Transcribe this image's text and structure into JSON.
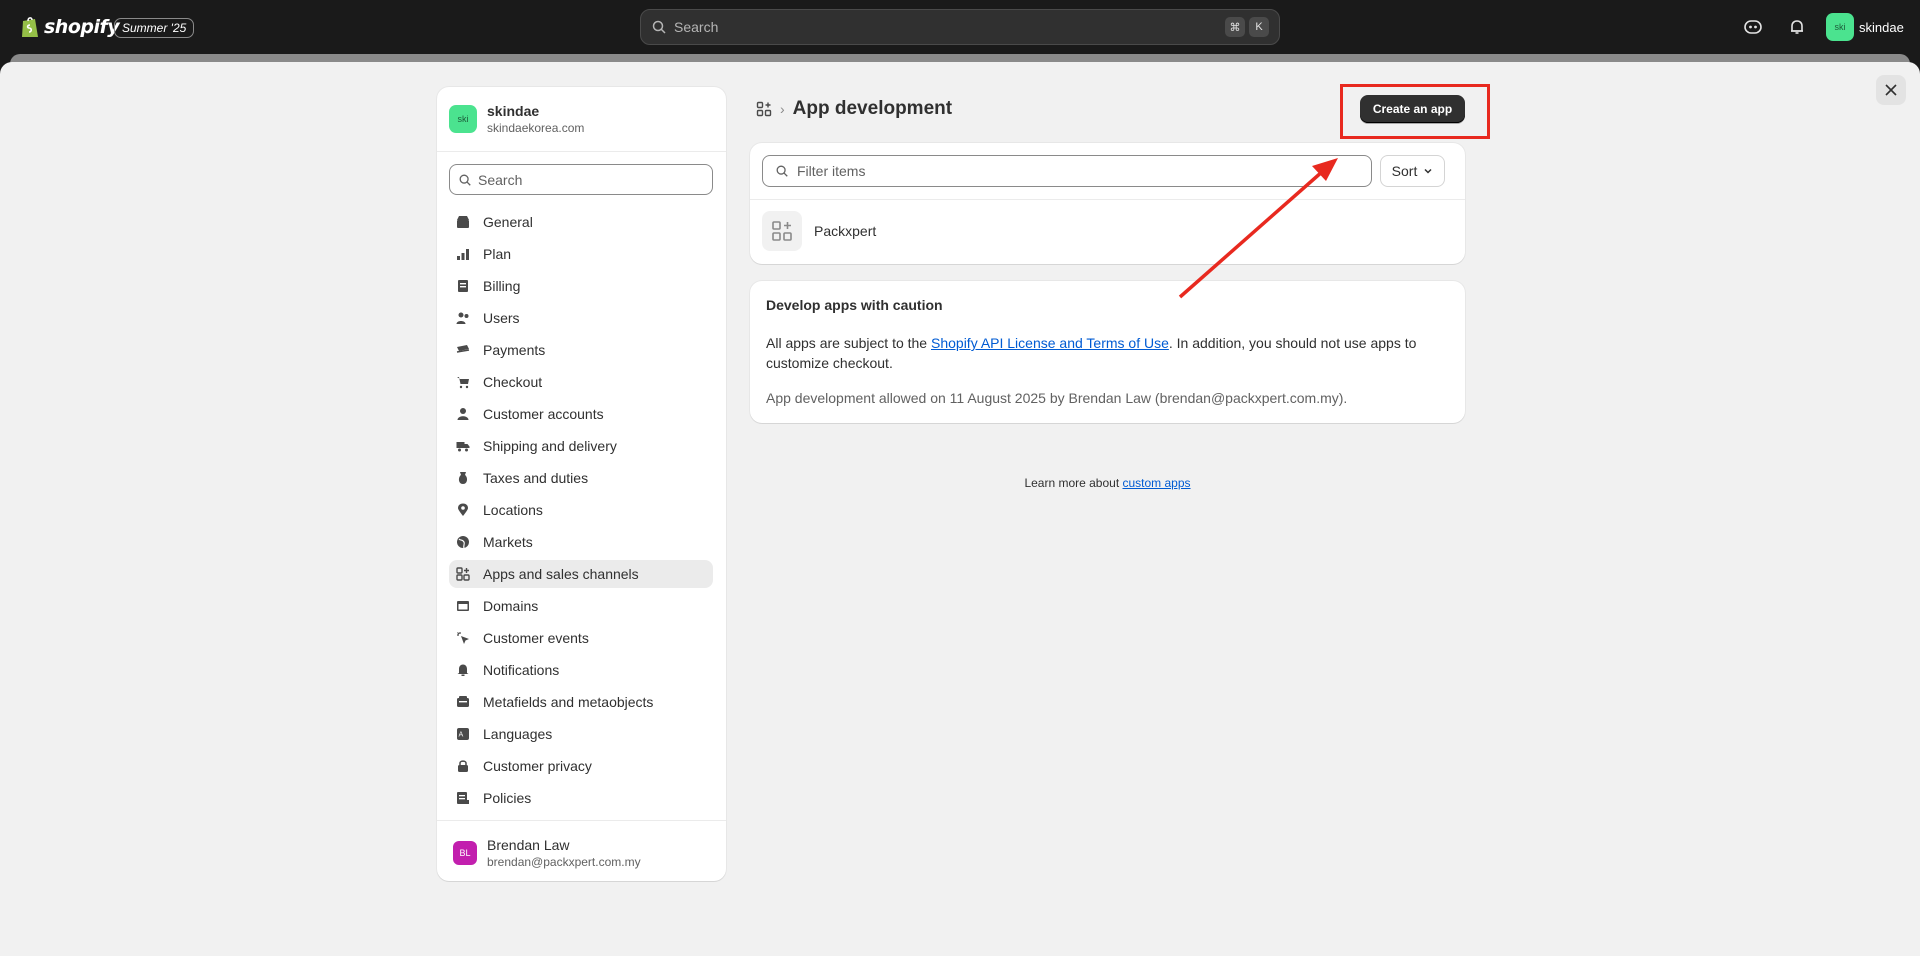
{
  "topbar": {
    "brand": "shopify",
    "edition_badge": "Summer '25",
    "search_placeholder": "Search",
    "shortcut_keys": [
      "⌘",
      "K"
    ],
    "store_name": "skindae",
    "store_avatar": "ski"
  },
  "sidebar": {
    "store": {
      "avatar": "ski",
      "name": "skindae",
      "domain": "skindaekorea.com"
    },
    "search_placeholder": "Search",
    "items": [
      {
        "label": "General",
        "icon": "store-icon"
      },
      {
        "label": "Plan",
        "icon": "plan-icon"
      },
      {
        "label": "Billing",
        "icon": "billing-icon"
      },
      {
        "label": "Users",
        "icon": "users-icon"
      },
      {
        "label": "Payments",
        "icon": "payments-icon"
      },
      {
        "label": "Checkout",
        "icon": "cart-icon"
      },
      {
        "label": "Customer accounts",
        "icon": "person-icon"
      },
      {
        "label": "Shipping and delivery",
        "icon": "truck-icon"
      },
      {
        "label": "Taxes and duties",
        "icon": "tax-icon"
      },
      {
        "label": "Locations",
        "icon": "location-icon"
      },
      {
        "label": "Markets",
        "icon": "globe-icon"
      },
      {
        "label": "Apps and sales channels",
        "icon": "apps-icon",
        "active": true
      },
      {
        "label": "Domains",
        "icon": "domain-icon"
      },
      {
        "label": "Customer events",
        "icon": "cursor-icon"
      },
      {
        "label": "Notifications",
        "icon": "bell-icon"
      },
      {
        "label": "Metafields and metaobjects",
        "icon": "metafields-icon"
      },
      {
        "label": "Languages",
        "icon": "language-icon"
      },
      {
        "label": "Customer privacy",
        "icon": "lock-icon"
      },
      {
        "label": "Policies",
        "icon": "policy-icon"
      }
    ],
    "user": {
      "avatar": "BL",
      "name": "Brendan Law",
      "email": "brendan@packxpert.com.my"
    }
  },
  "main": {
    "title": "App development",
    "create_button": "Create an app",
    "filter_placeholder": "Filter items",
    "sort_label": "Sort",
    "apps": [
      {
        "name": "Packxpert"
      }
    ],
    "caution": {
      "title": "Develop apps with caution",
      "body_prefix": "All apps are subject to the ",
      "body_link": "Shopify API License and Terms of Use",
      "body_suffix": ". In addition, you should not use apps to customize checkout.",
      "note": "App development allowed on 11 August 2025 by Brendan Law (brendan@packxpert.com.my)."
    },
    "learn_more_prefix": "Learn more about ",
    "learn_more_link": "custom apps"
  },
  "colors": {
    "accent_dark": "#303030",
    "annotation_red": "#e8291f",
    "link": "#005bd3",
    "store_avatar": "#4be38f",
    "user_avatar": "#c21fae"
  }
}
